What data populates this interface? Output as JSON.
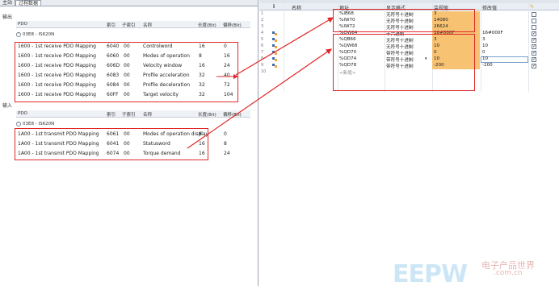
{
  "tabs": [
    "主站",
    "过程数据"
  ],
  "left": {
    "output_label": "输出",
    "input_label": "输入",
    "columns": [
      "PDO",
      "索引",
      "子索引",
      "名称",
      "长度(Bit)",
      "偏移(Bit)"
    ],
    "output_group": "03E8 - IS620N",
    "input_group": "03E8 - IS620N",
    "output_rows": [
      {
        "pdo": "1600 - 1st receive PDO Mapping",
        "index": "6040",
        "sub": "00",
        "name": "Controlword",
        "len": "16",
        "off": "0"
      },
      {
        "pdo": "1600 - 1st receive PDO Mapping",
        "index": "6060",
        "sub": "00",
        "name": "Modes of operation",
        "len": "8",
        "off": "16"
      },
      {
        "pdo": "1600 - 1st receive PDO Mapping",
        "index": "606D",
        "sub": "00",
        "name": "Velocity window",
        "len": "16",
        "off": "24"
      },
      {
        "pdo": "1600 - 1st receive PDO Mapping",
        "index": "6083",
        "sub": "00",
        "name": "Profile acceleration",
        "len": "32",
        "off": "40"
      },
      {
        "pdo": "1600 - 1st receive PDO Mapping",
        "index": "6084",
        "sub": "00",
        "name": "Profile deceleration",
        "len": "32",
        "off": "72"
      },
      {
        "pdo": "1600 - 1st receive PDO Mapping",
        "index": "60FF",
        "sub": "00",
        "name": "Target velocity",
        "len": "32",
        "off": "104"
      }
    ],
    "input_rows": [
      {
        "pdo": "1A00 - 1st transmit PDO Mapping",
        "index": "6061",
        "sub": "00",
        "name": "Modes of operation display",
        "len": "8",
        "off": "0"
      },
      {
        "pdo": "1A00 - 1st transmit PDO Mapping",
        "index": "6041",
        "sub": "00",
        "name": "Statusword",
        "len": "16",
        "off": "8"
      },
      {
        "pdo": "1A00 - 1st transmit PDO Mapping",
        "index": "6074",
        "sub": "00",
        "name": "Torque demand",
        "len": "16",
        "off": "24"
      }
    ]
  },
  "right": {
    "columns": {
      "name": "名称",
      "address": "地址",
      "format": "显示格式",
      "monitor": "监视值",
      "modify": "修改值"
    },
    "rows": [
      {
        "num": "1",
        "addr": "%IB68",
        "fmt": "无符号十进制",
        "mon": "3",
        "mod": "",
        "chk": false
      },
      {
        "num": "2",
        "addr": "%IW70",
        "fmt": "无符号十进制",
        "mon": "14080",
        "mod": "",
        "chk": false
      },
      {
        "num": "3",
        "addr": "%IW72",
        "fmt": "无符号十进制",
        "mon": "26624",
        "mod": "",
        "chk": false
      },
      {
        "num": "4",
        "addr": "%QW64",
        "fmt": "十六进制",
        "mon": "16#000F",
        "mod": "16#000F",
        "chk": true
      },
      {
        "num": "5",
        "addr": "%QB66",
        "fmt": "无符号十进制",
        "mon": "3",
        "mod": "3",
        "chk": true
      },
      {
        "num": "6",
        "addr": "%QW68",
        "fmt": "无符号十进制",
        "mon": "10",
        "mod": "10",
        "chk": true
      },
      {
        "num": "7",
        "addr": "%QD70",
        "fmt": "带符号十进制",
        "mon": "0",
        "mod": "0",
        "chk": true
      },
      {
        "num": "8",
        "addr": "%QD74",
        "fmt": "带符号十进制",
        "mon": "10",
        "mod": "10",
        "chk": true
      },
      {
        "num": "9",
        "addr": "%QD78",
        "fmt": "带符号十进制",
        "mon": "-200",
        "mod": "-200",
        "chk": true
      },
      {
        "num": "10",
        "addr": "<新增>",
        "fmt": "",
        "mon": "",
        "mod": "",
        "chk": false
      }
    ]
  },
  "watermark": {
    "logo": "EEPW",
    "cn": "电子产品世界",
    "url": ".com.cn"
  },
  "colors": {
    "highlight": "#e0282a",
    "value_bg": "#f7c272"
  }
}
